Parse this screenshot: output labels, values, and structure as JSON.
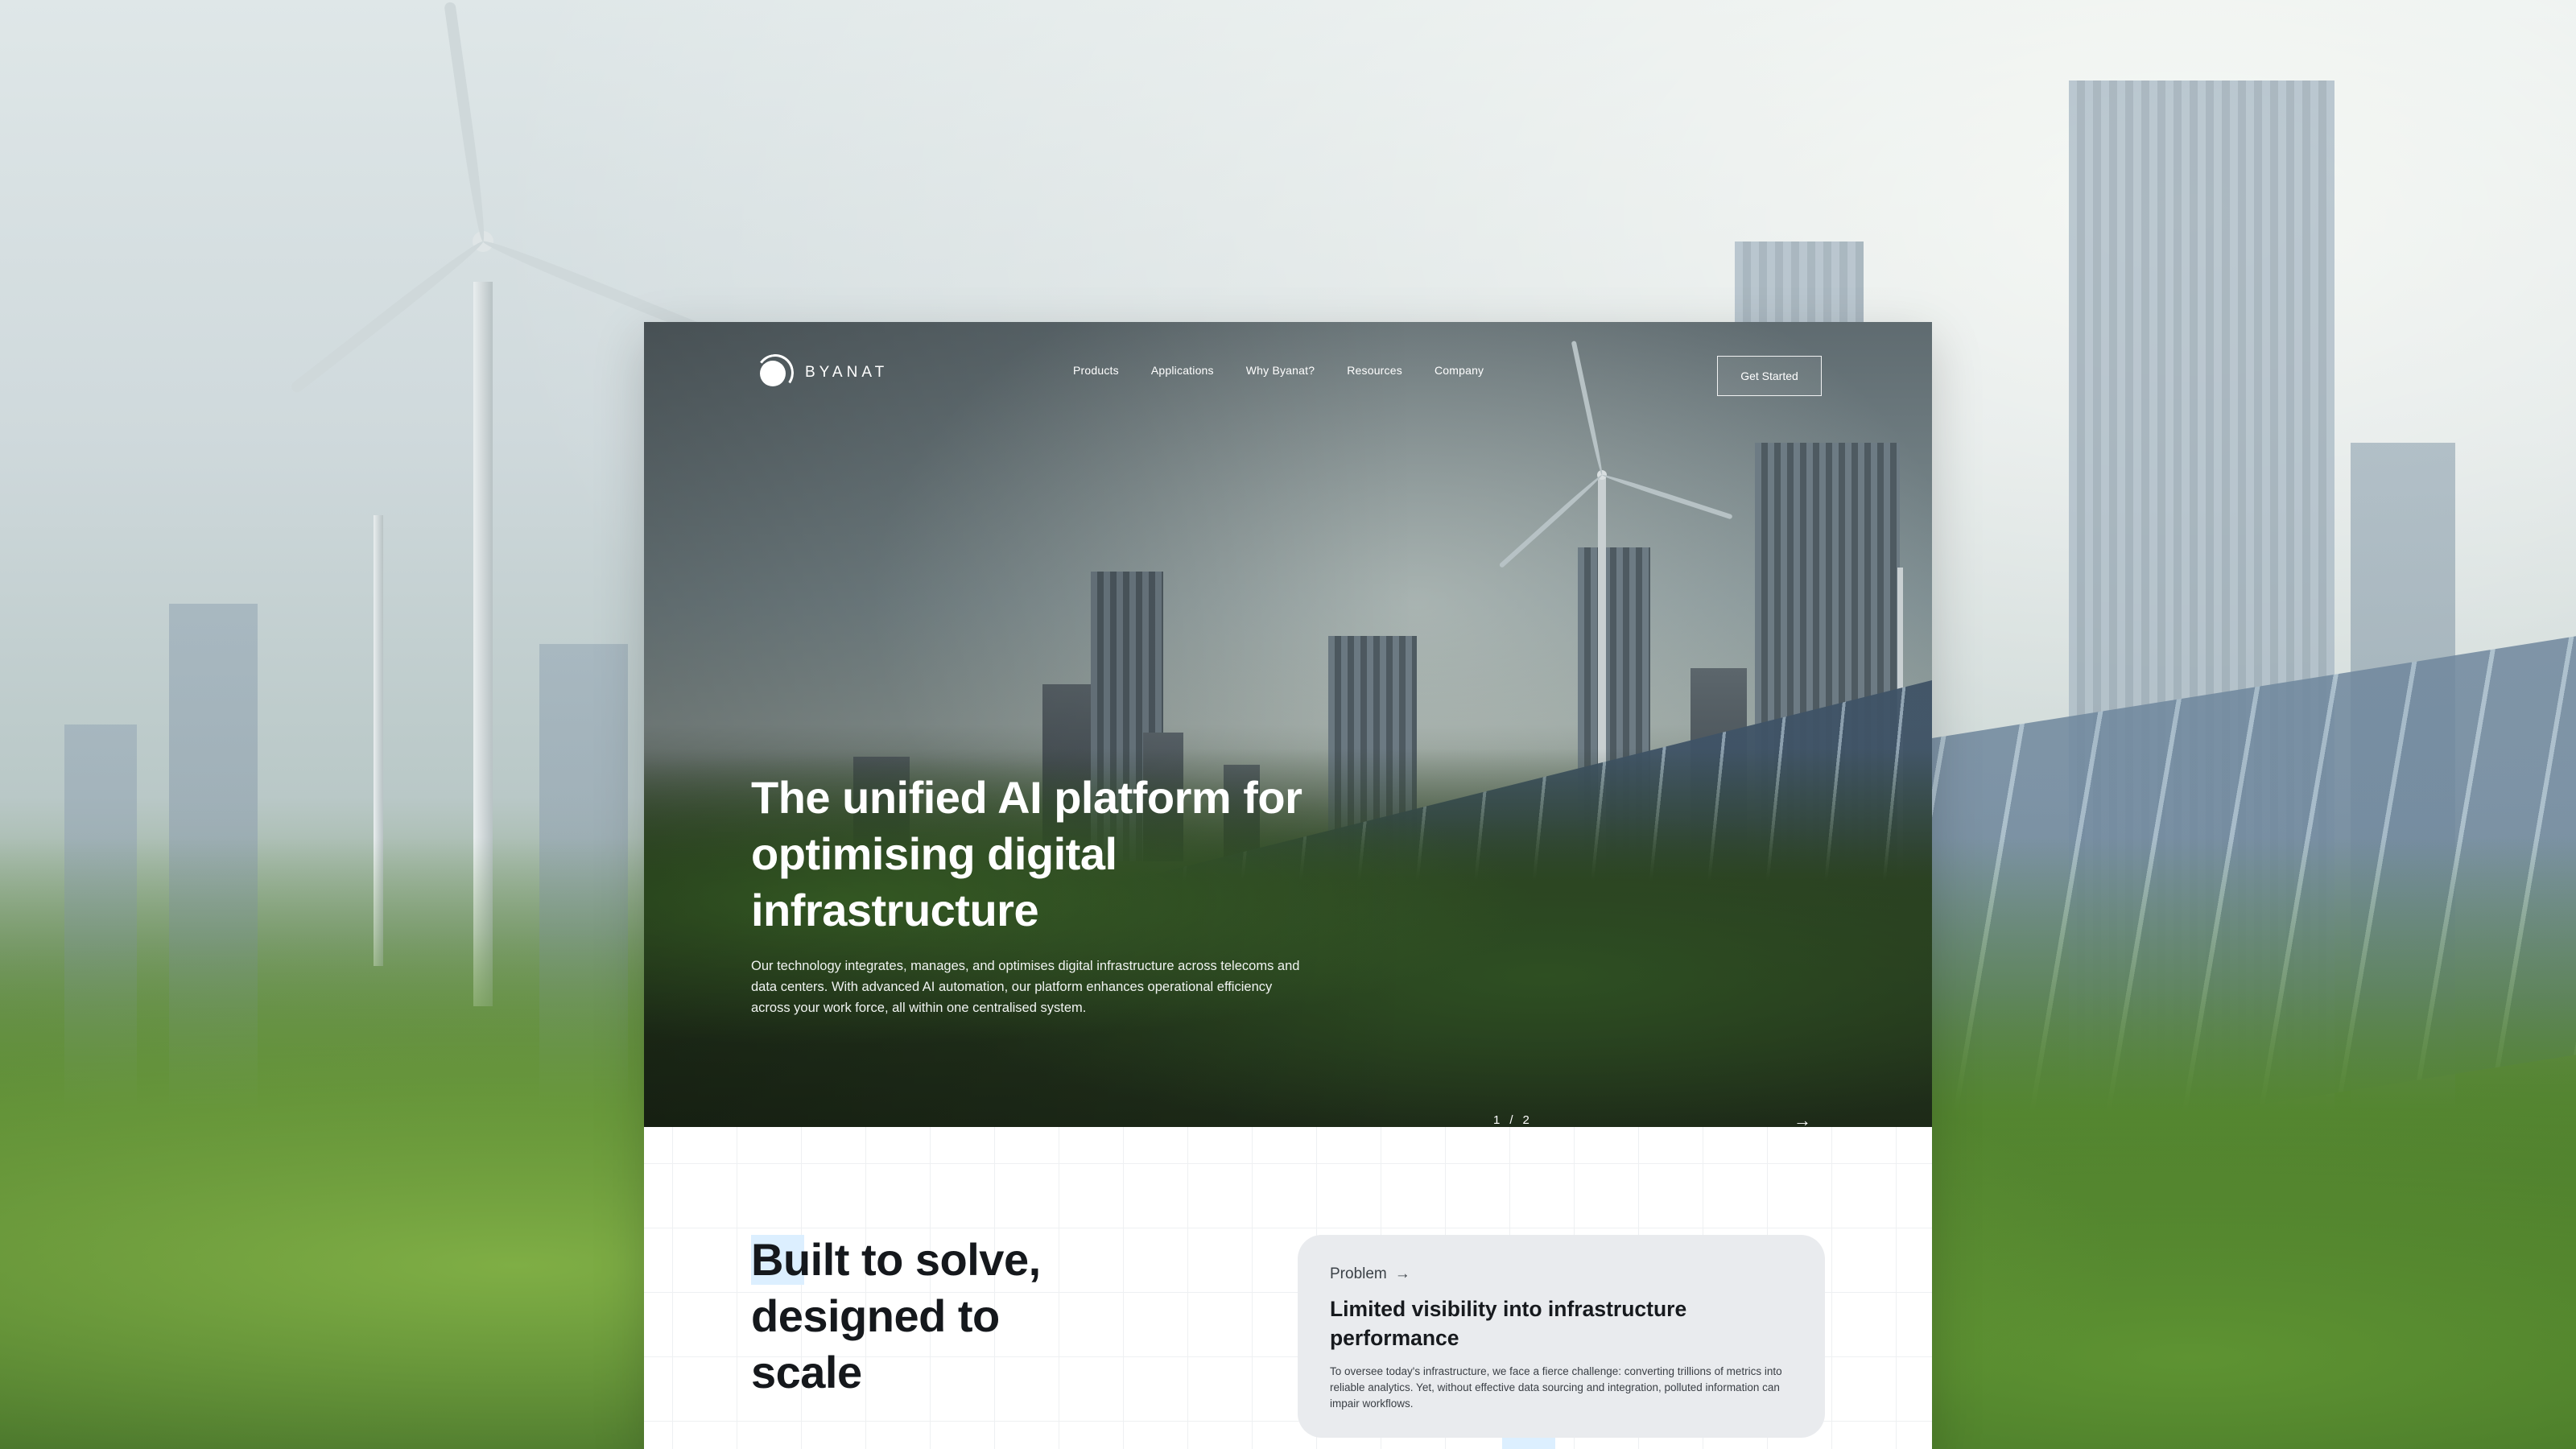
{
  "brand": {
    "name": "BYANAT"
  },
  "nav": {
    "items": [
      {
        "label": "Products"
      },
      {
        "label": "Applications"
      },
      {
        "label": "Why Byanat?"
      },
      {
        "label": "Resources"
      },
      {
        "label": "Company"
      }
    ],
    "cta_label": "Get Started"
  },
  "hero": {
    "headline": "The unified AI platform for optimising digital infrastructure",
    "subtext": "Our technology integrates, manages, and optimises digital infrastructure across telecoms and data centers. With advanced AI automation, our platform enhances operational efficiency across your work force, all within one centralised system."
  },
  "slider": {
    "current": "1",
    "separator": "/",
    "total": "2",
    "next_icon": "arrow-right-icon"
  },
  "section": {
    "title": "Built to solve, designed to scale",
    "problem_card": {
      "tag": "Problem",
      "tag_icon": "arrow-right-icon",
      "title": "Limited visibility into infrastructure performance",
      "body": "To oversee today's infrastructure, we face a fierce challenge: converting trillions of metrics into reliable analytics. Yet, without effective data sourcing and integration, polluted information can impair workflows."
    }
  },
  "colors": {
    "card_accent": "#dcefff",
    "problem_card_bg": "#e9ebee",
    "text_dark": "#15181c"
  }
}
